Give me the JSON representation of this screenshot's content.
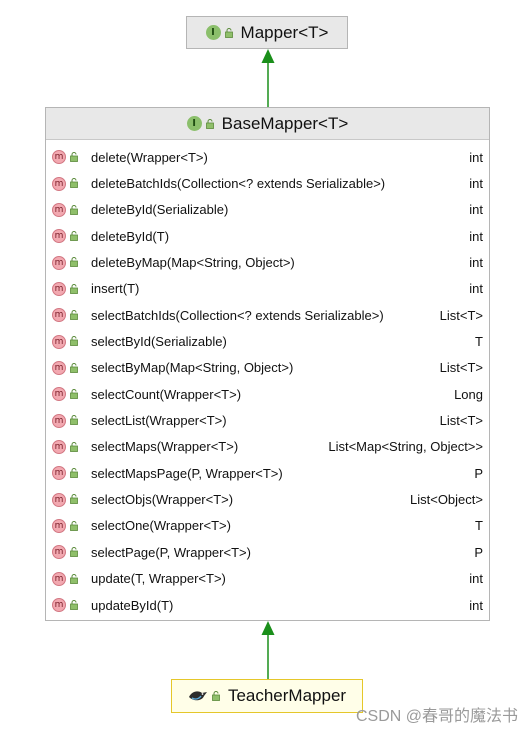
{
  "mapper": {
    "title": "Mapper<T>"
  },
  "base_mapper": {
    "title": "BaseMapper<T>",
    "methods": [
      {
        "sig": "delete(Wrapper<T>)",
        "ret": "int"
      },
      {
        "sig": "deleteBatchIds(Collection<? extends Serializable>)",
        "ret": "int"
      },
      {
        "sig": "deleteById(Serializable)",
        "ret": "int"
      },
      {
        "sig": "deleteById(T)",
        "ret": "int"
      },
      {
        "sig": "deleteByMap(Map<String, Object>)",
        "ret": "int"
      },
      {
        "sig": "insert(T)",
        "ret": "int"
      },
      {
        "sig": "selectBatchIds(Collection<? extends Serializable>)",
        "ret": "List<T>"
      },
      {
        "sig": "selectById(Serializable)",
        "ret": "T"
      },
      {
        "sig": "selectByMap(Map<String, Object>)",
        "ret": "List<T>"
      },
      {
        "sig": "selectCount(Wrapper<T>)",
        "ret": "Long"
      },
      {
        "sig": "selectList(Wrapper<T>)",
        "ret": "List<T>"
      },
      {
        "sig": "selectMaps(Wrapper<T>)",
        "ret": "List<Map<String, Object>>"
      },
      {
        "sig": "selectMapsPage(P, Wrapper<T>)",
        "ret": "P"
      },
      {
        "sig": "selectObjs(Wrapper<T>)",
        "ret": "List<Object>"
      },
      {
        "sig": "selectOne(Wrapper<T>)",
        "ret": "T"
      },
      {
        "sig": "selectPage(P, Wrapper<T>)",
        "ret": "P"
      },
      {
        "sig": "update(T, Wrapper<T>)",
        "ret": "int"
      },
      {
        "sig": "updateById(T)",
        "ret": "int"
      }
    ]
  },
  "teacher_mapper": {
    "title": "TeacherMapper"
  },
  "badges": {
    "interface": "I",
    "method": "m"
  },
  "watermark": "CSDN @春哥的魔法书",
  "colors": {
    "arrow": "#1a8f1a",
    "interface_badge": "#8bbf6b",
    "method_badge": "#f2a8b0",
    "teacher_border": "#e5c72a"
  },
  "icons": {
    "interface": "interface-badge-icon",
    "method": "method-badge-icon",
    "lock": "lock-icon",
    "mapper": "mybatis-bird-icon"
  }
}
